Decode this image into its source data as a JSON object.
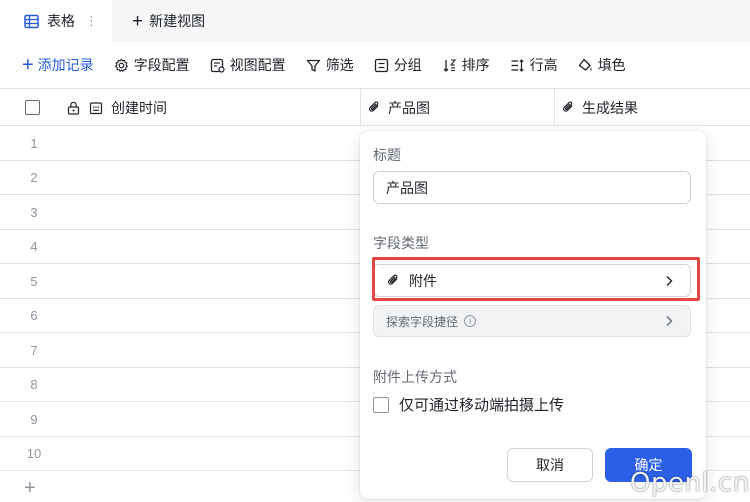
{
  "tabs": {
    "active_label": "表格",
    "new_view_label": "新建视图"
  },
  "toolbar": {
    "add_record": "添加记录",
    "field_config": "字段配置",
    "view_config": "视图配置",
    "filter": "筛选",
    "group": "分组",
    "sort": "排序",
    "row_height": "行高",
    "fill_color": "填色"
  },
  "grid": {
    "columns": [
      {
        "label": "创建时间",
        "icon": "calendar-icon"
      },
      {
        "label": "产品图",
        "icon": "attachment-icon"
      },
      {
        "label": "生成结果",
        "icon": "attachment-icon"
      }
    ],
    "rows": [
      "1",
      "2",
      "3",
      "4",
      "5",
      "6",
      "7",
      "8",
      "9",
      "10"
    ],
    "add_row": "+"
  },
  "popover": {
    "title_label": "标题",
    "title_value": "产品图",
    "field_type_label": "字段类型",
    "field_type_value": "附件",
    "search_shortcut": "探索字段捷径",
    "upload_label": "附件上传方式",
    "mobile_only_option": "仅可通过移动端拍摄上传",
    "cancel": "取消",
    "confirm": "确定"
  },
  "watermark": "Openl.cn",
  "colors": {
    "accent": "#245bdb",
    "primary_button": "#2b5fe7",
    "highlight": "#e64545"
  }
}
